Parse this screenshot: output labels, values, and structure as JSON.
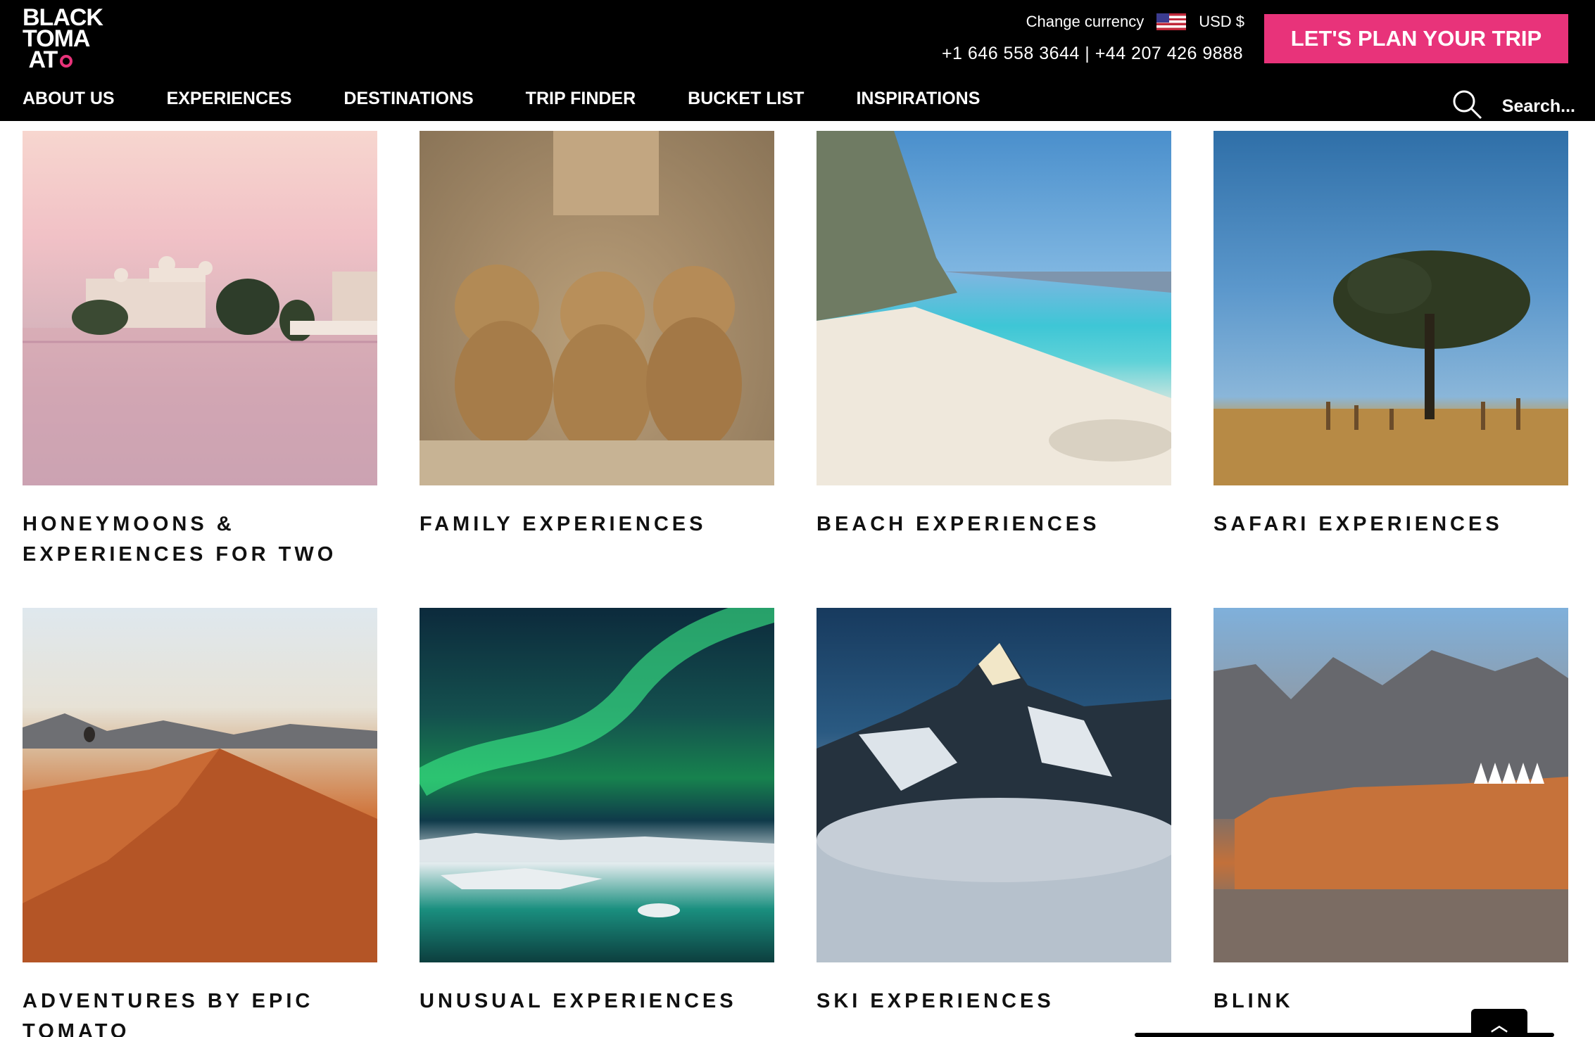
{
  "header": {
    "logo_text": "BLACK TOMATO",
    "currency_label": "Change currency",
    "currency_value": "USD $",
    "phones": "+1 646 558 3644 | +44 207 426 9888",
    "cta": "LET'S PLAN YOUR TRIP"
  },
  "nav": {
    "items": [
      "ABOUT US",
      "EXPERIENCES",
      "DESTINATIONS",
      "TRIP FINDER",
      "BUCKET LIST",
      "INSPIRATIONS"
    ],
    "search_placeholder": "Search..."
  },
  "cards": [
    {
      "title": "HONEYMOONS & EXPERIENCES FOR TWO"
    },
    {
      "title": "FAMILY EXPERIENCES"
    },
    {
      "title": "BEACH EXPERIENCES"
    },
    {
      "title": "SAFARI EXPERIENCES"
    },
    {
      "title": "ADVENTURES BY EPIC TOMATO"
    },
    {
      "title": "UNUSUAL EXPERIENCES"
    },
    {
      "title": "SKI EXPERIENCES"
    },
    {
      "title": "BLINK"
    }
  ],
  "colors": {
    "accent": "#e8337a",
    "header_bg": "#000000"
  },
  "icons": {
    "search": "search-icon",
    "back_to_top": "chevron-up-icon",
    "flag": "us-flag-icon"
  }
}
